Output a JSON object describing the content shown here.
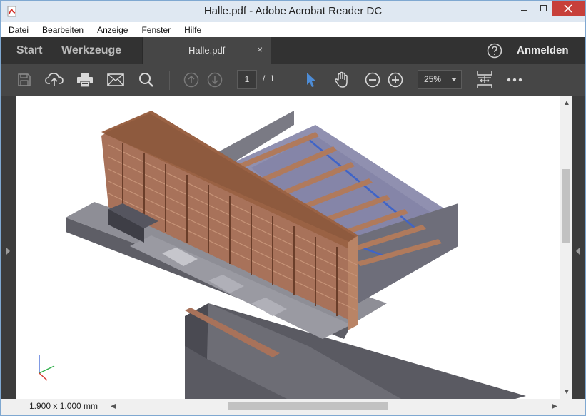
{
  "window": {
    "title": "Halle.pdf - Adobe Acrobat Reader DC"
  },
  "menu": {
    "items": [
      "Datei",
      "Bearbeiten",
      "Anzeige",
      "Fenster",
      "Hilfe"
    ]
  },
  "tabs": {
    "start": "Start",
    "tools": "Werkzeuge",
    "document": "Halle.pdf",
    "close_glyph": "×",
    "sign_in": "Anmelden"
  },
  "toolbar": {
    "icons": [
      "save-icon",
      "upload-cloud-icon",
      "print-icon",
      "mail-icon",
      "search-icon",
      "page-up-icon",
      "page-down-icon",
      "select-arrow-icon",
      "hand-icon",
      "zoom-out-icon",
      "zoom-in-icon",
      "fit-page-icon",
      "more-icon"
    ],
    "current_page": "1",
    "page_separator": "/",
    "total_pages": "1",
    "zoom": "25%"
  },
  "status": {
    "page_size": "1.900 x 1.000 mm"
  },
  "colors": {
    "accent_select": "#4d8cd6",
    "close_button": "#c7403a",
    "building_facade": "#a8725a",
    "building_roof": "#9a6244",
    "hall_interior": "#7d7a98"
  }
}
